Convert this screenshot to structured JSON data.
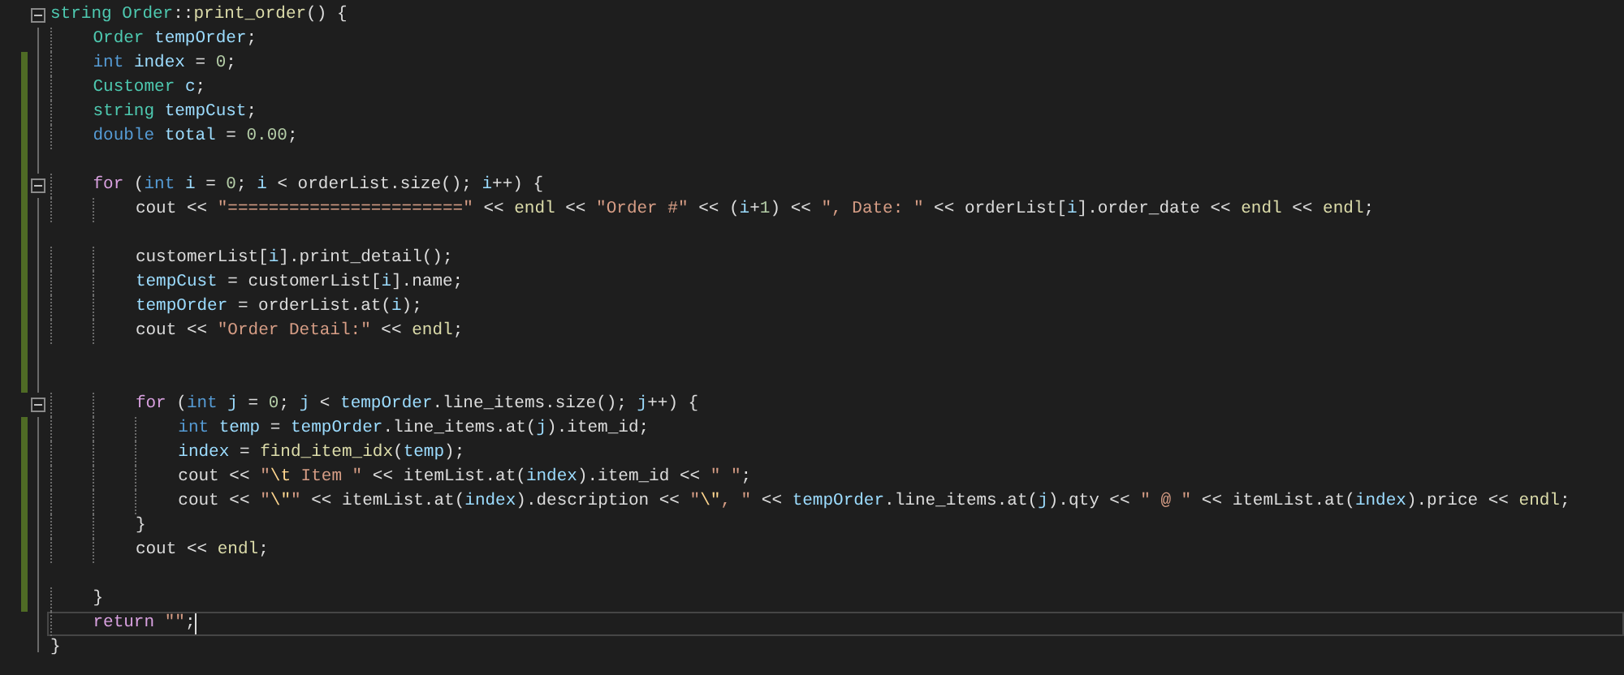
{
  "editor": {
    "lines": [
      {
        "changed": false,
        "fold": true,
        "current": false,
        "tokens": [
          {
            "kind": "type",
            "text": "string Order"
          },
          {
            "kind": "plain",
            "text": "::"
          },
          {
            "kind": "fn",
            "text": "print_order"
          },
          {
            "kind": "plain",
            "text": "() {"
          }
        ]
      },
      {
        "changed": false,
        "fold": false,
        "current": false,
        "tokens": [
          {
            "kind": "type",
            "text": "    Order "
          },
          {
            "kind": "local",
            "text": "tempOrder"
          },
          {
            "kind": "plain",
            "text": ";"
          }
        ]
      },
      {
        "changed": true,
        "fold": false,
        "current": false,
        "tokens": [
          {
            "kind": "keyword",
            "text": "    int "
          },
          {
            "kind": "local",
            "text": "index"
          },
          {
            "kind": "plain",
            "text": " = "
          },
          {
            "kind": "number",
            "text": "0"
          },
          {
            "kind": "plain",
            "text": ";"
          }
        ]
      },
      {
        "changed": true,
        "fold": false,
        "current": false,
        "tokens": [
          {
            "kind": "type",
            "text": "    Customer "
          },
          {
            "kind": "local",
            "text": "c"
          },
          {
            "kind": "plain",
            "text": ";"
          }
        ]
      },
      {
        "changed": true,
        "fold": false,
        "current": false,
        "tokens": [
          {
            "kind": "type",
            "text": "    string "
          },
          {
            "kind": "local",
            "text": "tempCust"
          },
          {
            "kind": "plain",
            "text": ";"
          }
        ]
      },
      {
        "changed": true,
        "fold": false,
        "current": false,
        "tokens": [
          {
            "kind": "keyword",
            "text": "    double "
          },
          {
            "kind": "local",
            "text": "total"
          },
          {
            "kind": "plain",
            "text": " = "
          },
          {
            "kind": "number",
            "text": "0.00"
          },
          {
            "kind": "plain",
            "text": ";"
          }
        ]
      },
      {
        "changed": true,
        "fold": false,
        "current": false
      },
      {
        "changed": true,
        "fold": true,
        "current": false,
        "tokens": [
          {
            "kind": "control",
            "text": "    for"
          },
          {
            "kind": "plain",
            "text": " ("
          },
          {
            "kind": "keyword",
            "text": "int "
          },
          {
            "kind": "local",
            "text": "i"
          },
          {
            "kind": "plain",
            "text": " = "
          },
          {
            "kind": "number",
            "text": "0"
          },
          {
            "kind": "plain",
            "text": "; "
          },
          {
            "kind": "local",
            "text": "i"
          },
          {
            "kind": "plain",
            "text": " < orderList.size(); "
          },
          {
            "kind": "local",
            "text": "i"
          },
          {
            "kind": "plain",
            "text": "++) {"
          }
        ]
      },
      {
        "changed": true,
        "fold": false,
        "current": false,
        "tokens": [
          {
            "kind": "plain",
            "text": "        cout << "
          },
          {
            "kind": "string",
            "text": "\"=======================\""
          },
          {
            "kind": "plain",
            "text": " << "
          },
          {
            "kind": "fn",
            "text": "endl"
          },
          {
            "kind": "plain",
            "text": " << "
          },
          {
            "kind": "string",
            "text": "\"Order #\""
          },
          {
            "kind": "plain",
            "text": " << ("
          },
          {
            "kind": "local",
            "text": "i"
          },
          {
            "kind": "plain",
            "text": "+"
          },
          {
            "kind": "number",
            "text": "1"
          },
          {
            "kind": "plain",
            "text": ") << "
          },
          {
            "kind": "string",
            "text": "\", Date: \""
          },
          {
            "kind": "plain",
            "text": " << orderList["
          },
          {
            "kind": "local",
            "text": "i"
          },
          {
            "kind": "plain",
            "text": "].order_date << "
          },
          {
            "kind": "fn",
            "text": "endl"
          },
          {
            "kind": "plain",
            "text": " << "
          },
          {
            "kind": "fn",
            "text": "endl"
          },
          {
            "kind": "plain",
            "text": ";"
          }
        ]
      },
      {
        "changed": true,
        "fold": false,
        "current": false
      },
      {
        "changed": true,
        "fold": false,
        "current": false,
        "tokens": [
          {
            "kind": "plain",
            "text": "        customerList["
          },
          {
            "kind": "local",
            "text": "i"
          },
          {
            "kind": "plain",
            "text": "].print_detail();"
          }
        ]
      },
      {
        "changed": true,
        "fold": false,
        "current": false,
        "tokens": [
          {
            "kind": "local",
            "text": "        tempCust"
          },
          {
            "kind": "plain",
            "text": " = customerList["
          },
          {
            "kind": "local",
            "text": "i"
          },
          {
            "kind": "plain",
            "text": "].name;"
          }
        ]
      },
      {
        "changed": true,
        "fold": false,
        "current": false,
        "tokens": [
          {
            "kind": "local",
            "text": "        tempOrder"
          },
          {
            "kind": "plain",
            "text": " = orderList.at("
          },
          {
            "kind": "local",
            "text": "i"
          },
          {
            "kind": "plain",
            "text": ");"
          }
        ]
      },
      {
        "changed": true,
        "fold": false,
        "current": false,
        "tokens": [
          {
            "kind": "plain",
            "text": "        cout << "
          },
          {
            "kind": "string",
            "text": "\"Order Detail:\""
          },
          {
            "kind": "plain",
            "text": " << "
          },
          {
            "kind": "fn",
            "text": "endl"
          },
          {
            "kind": "plain",
            "text": ";"
          }
        ]
      },
      {
        "changed": true,
        "fold": false,
        "current": false
      },
      {
        "changed": true,
        "fold": false,
        "current": false
      },
      {
        "changed": false,
        "fold": true,
        "current": false,
        "tokens": [
          {
            "kind": "control",
            "text": "        for"
          },
          {
            "kind": "plain",
            "text": " ("
          },
          {
            "kind": "keyword",
            "text": "int "
          },
          {
            "kind": "local",
            "text": "j"
          },
          {
            "kind": "plain",
            "text": " = "
          },
          {
            "kind": "number",
            "text": "0"
          },
          {
            "kind": "plain",
            "text": "; "
          },
          {
            "kind": "local",
            "text": "j"
          },
          {
            "kind": "plain",
            "text": " < "
          },
          {
            "kind": "local",
            "text": "tempOrder"
          },
          {
            "kind": "plain",
            "text": ".line_items.size(); "
          },
          {
            "kind": "local",
            "text": "j"
          },
          {
            "kind": "plain",
            "text": "++) {"
          }
        ]
      },
      {
        "changed": true,
        "fold": false,
        "current": false,
        "tokens": [
          {
            "kind": "keyword",
            "text": "            int "
          },
          {
            "kind": "local",
            "text": "temp"
          },
          {
            "kind": "plain",
            "text": " = "
          },
          {
            "kind": "local",
            "text": "tempOrder"
          },
          {
            "kind": "plain",
            "text": ".line_items.at("
          },
          {
            "kind": "local",
            "text": "j"
          },
          {
            "kind": "plain",
            "text": ").item_id;"
          }
        ]
      },
      {
        "changed": true,
        "fold": false,
        "current": false,
        "tokens": [
          {
            "kind": "local",
            "text": "            index"
          },
          {
            "kind": "plain",
            "text": " = "
          },
          {
            "kind": "fn",
            "text": "find_item_idx"
          },
          {
            "kind": "plain",
            "text": "("
          },
          {
            "kind": "local",
            "text": "temp"
          },
          {
            "kind": "plain",
            "text": ");"
          }
        ]
      },
      {
        "changed": true,
        "fold": false,
        "current": false,
        "tokens": [
          {
            "kind": "plain",
            "text": "            cout << "
          },
          {
            "kind": "string",
            "text": "\""
          },
          {
            "kind": "escape",
            "text": "\\t"
          },
          {
            "kind": "string",
            "text": " Item \""
          },
          {
            "kind": "plain",
            "text": " << itemList.at("
          },
          {
            "kind": "local",
            "text": "index"
          },
          {
            "kind": "plain",
            "text": ").item_id << "
          },
          {
            "kind": "string",
            "text": "\" \""
          },
          {
            "kind": "plain",
            "text": ";"
          }
        ]
      },
      {
        "changed": true,
        "fold": false,
        "current": false,
        "tokens": [
          {
            "kind": "plain",
            "text": "            cout << "
          },
          {
            "kind": "string",
            "text": "\""
          },
          {
            "kind": "escape",
            "text": "\\\""
          },
          {
            "kind": "string",
            "text": "\""
          },
          {
            "kind": "plain",
            "text": " << itemList.at("
          },
          {
            "kind": "local",
            "text": "index"
          },
          {
            "kind": "plain",
            "text": ").description << "
          },
          {
            "kind": "string",
            "text": "\""
          },
          {
            "kind": "escape",
            "text": "\\\""
          },
          {
            "kind": "string",
            "text": ", \""
          },
          {
            "kind": "plain",
            "text": " << "
          },
          {
            "kind": "local",
            "text": "tempOrder"
          },
          {
            "kind": "plain",
            "text": ".line_items.at("
          },
          {
            "kind": "local",
            "text": "j"
          },
          {
            "kind": "plain",
            "text": ").qty << "
          },
          {
            "kind": "string",
            "text": "\" @ \""
          },
          {
            "kind": "plain",
            "text": " << itemList.at("
          },
          {
            "kind": "local",
            "text": "index"
          },
          {
            "kind": "plain",
            "text": ").price << "
          },
          {
            "kind": "fn",
            "text": "endl"
          },
          {
            "kind": "plain",
            "text": ";"
          }
        ]
      },
      {
        "changed": true,
        "fold": false,
        "current": false,
        "tokens": [
          {
            "kind": "plain",
            "text": "        }"
          }
        ]
      },
      {
        "changed": true,
        "fold": false,
        "current": false,
        "tokens": [
          {
            "kind": "plain",
            "text": "        cout << "
          },
          {
            "kind": "fn",
            "text": "endl"
          },
          {
            "kind": "plain",
            "text": ";"
          }
        ]
      },
      {
        "changed": true,
        "fold": false,
        "current": false
      },
      {
        "changed": true,
        "fold": false,
        "current": false,
        "tokens": [
          {
            "kind": "plain",
            "text": "    }"
          }
        ]
      },
      {
        "changed": false,
        "fold": false,
        "current": true,
        "tokens": [
          {
            "kind": "control",
            "text": "    return "
          },
          {
            "kind": "string",
            "text": "\"\""
          },
          {
            "kind": "plain",
            "text": ";"
          }
        ]
      },
      {
        "changed": false,
        "fold": false,
        "current": false,
        "tokens": [
          {
            "kind": "plain",
            "text": "}"
          }
        ]
      }
    ]
  }
}
